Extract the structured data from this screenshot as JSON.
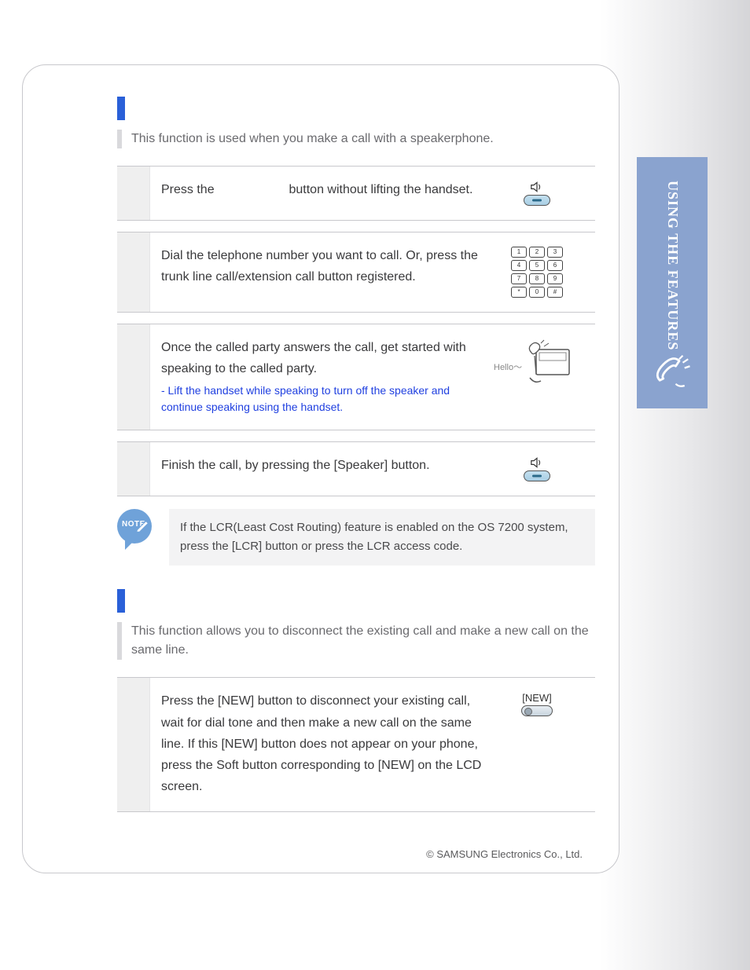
{
  "sideTab": {
    "title": "USING THE FEATURES"
  },
  "section1": {
    "intro": "This function is used when you make a call with a speakerphone.",
    "step1": {
      "textA": "Press the ",
      "textB": " button without lifting the handset."
    },
    "step2": {
      "text": "Dial the telephone number you want to call. Or, press the trunk line call/extension call button registered."
    },
    "step3": {
      "text": "Once the called party answers the call, get started with speaking to the called party.",
      "sub": "- Lift the handset while speaking to turn off the speaker and continue speaking using the handset.",
      "hello": "Hello～"
    },
    "step4": {
      "text": "Finish the call, by pressing the [Speaker] button."
    }
  },
  "note": {
    "badge": "NOTE",
    "text": "If the LCR(Least Cost Routing) feature is enabled on the OS 7200 system, press the [LCR] button or press the LCR access code."
  },
  "section2": {
    "intro": "This function allows you to disconnect the existing call and make a new call on the same line.",
    "step1": {
      "text": "Press the [NEW] button to disconnect your existing call, wait for dial tone and then make a new call on the same line. If this [NEW] button does not appear on your phone, press the Soft button corresponding to [NEW] on the LCD screen.",
      "btn": "[NEW]"
    }
  },
  "keypad": [
    "1",
    "2",
    "3",
    "4",
    "5",
    "6",
    "7",
    "8",
    "9",
    "*",
    "0",
    "#"
  ],
  "copyright": "© SAMSUNG Electronics Co., Ltd."
}
